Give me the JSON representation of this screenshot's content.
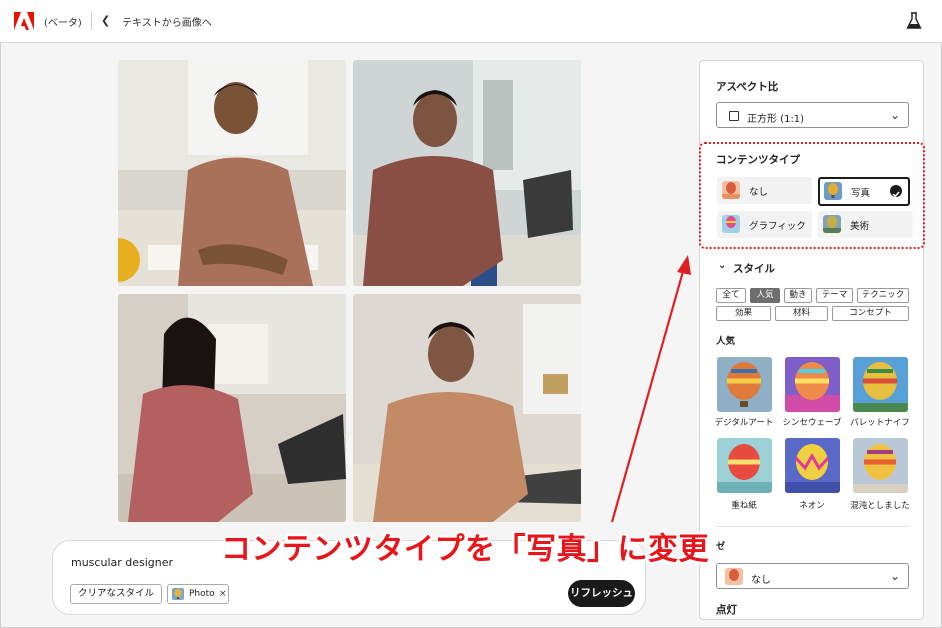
{
  "header": {
    "beta_label": "(ベータ)",
    "breadcrumb": "テキストから画像へ"
  },
  "prompt": {
    "text": "muscular designer",
    "clear_style_label": "クリアなスタイル",
    "chip_label": "Photo",
    "chip_remove": "×",
    "refresh_label": "リフレッシュ"
  },
  "panel": {
    "aspect": {
      "title": "アスペクト比",
      "value": "正方形 (1:1)"
    },
    "content_type": {
      "title": "コンテンツタイプ",
      "options": [
        {
          "label": "なし",
          "selected": false
        },
        {
          "label": "写真",
          "selected": true
        },
        {
          "label": "グラフィック",
          "selected": false
        },
        {
          "label": "美術",
          "selected": false
        }
      ]
    },
    "style": {
      "title": "スタイル",
      "tags_row1": [
        "全て",
        "人気",
        "動き",
        "テーマ",
        "テクニック"
      ],
      "tags_row2": [
        "効果",
        "材料",
        "コンセプト"
      ],
      "active_tag": "人気",
      "popular_title": "人気",
      "thumbnails": [
        {
          "label": "デジタルアート"
        },
        {
          "label": "シンセウェーブ"
        },
        {
          "label": "パレットナイフ"
        },
        {
          "label": "重ね紙"
        },
        {
          "label": "ネオン"
        },
        {
          "label": "混沌としました"
        }
      ]
    },
    "lower_select": {
      "title_partial": "ゼ",
      "value": "なし"
    },
    "lighting_title": "点灯"
  },
  "annotation": {
    "text": "コンテンツタイプを「写真」に変更",
    "color": "#e8151b"
  },
  "colors": {
    "accent": "#1a1a1a",
    "annotation_red": "#e02020",
    "adobe_red": "#eb1000"
  }
}
